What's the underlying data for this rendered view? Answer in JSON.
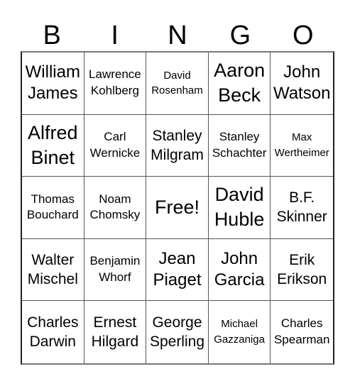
{
  "header": [
    "B",
    "I",
    "N",
    "G",
    "O"
  ],
  "cells": [
    {
      "text": "William\nJames",
      "size": "s-l"
    },
    {
      "text": "Lawrence\nKohlberg",
      "size": "s-s"
    },
    {
      "text": "David\nRosenham",
      "size": "s-xs"
    },
    {
      "text": "Aaron\nBeck",
      "size": "s-xl"
    },
    {
      "text": "John\nWatson",
      "size": "s-l"
    },
    {
      "text": "Alfred\nBinet",
      "size": "s-xl"
    },
    {
      "text": "Carl\nWernicke",
      "size": "s-s"
    },
    {
      "text": "Stanley\nMilgram",
      "size": "s-m"
    },
    {
      "text": "Stanley\nSchachter",
      "size": "s-s"
    },
    {
      "text": "Max\nWertheimer",
      "size": "s-xs"
    },
    {
      "text": "Thomas\nBouchard",
      "size": "s-s"
    },
    {
      "text": "Noam\nChomsky",
      "size": "s-s"
    },
    {
      "text": "Free!",
      "size": "s-xl",
      "free": true
    },
    {
      "text": "David\nHuble",
      "size": "s-xl"
    },
    {
      "text": "B.F.\nSkinner",
      "size": "s-m"
    },
    {
      "text": "Walter\nMischel",
      "size": "s-m"
    },
    {
      "text": "Benjamin\nWhorf",
      "size": "s-s"
    },
    {
      "text": "Jean\nPiaget",
      "size": "s-l"
    },
    {
      "text": "John\nGarcia",
      "size": "s-l"
    },
    {
      "text": "Erik\nErikson",
      "size": "s-m"
    },
    {
      "text": "Charles\nDarwin",
      "size": "s-m"
    },
    {
      "text": "Ernest\nHilgard",
      "size": "s-m"
    },
    {
      "text": "George\nSperling",
      "size": "s-m"
    },
    {
      "text": "Michael\nGazzaniga",
      "size": "s-xs"
    },
    {
      "text": "Charles\nSpearman",
      "size": "s-s"
    }
  ]
}
